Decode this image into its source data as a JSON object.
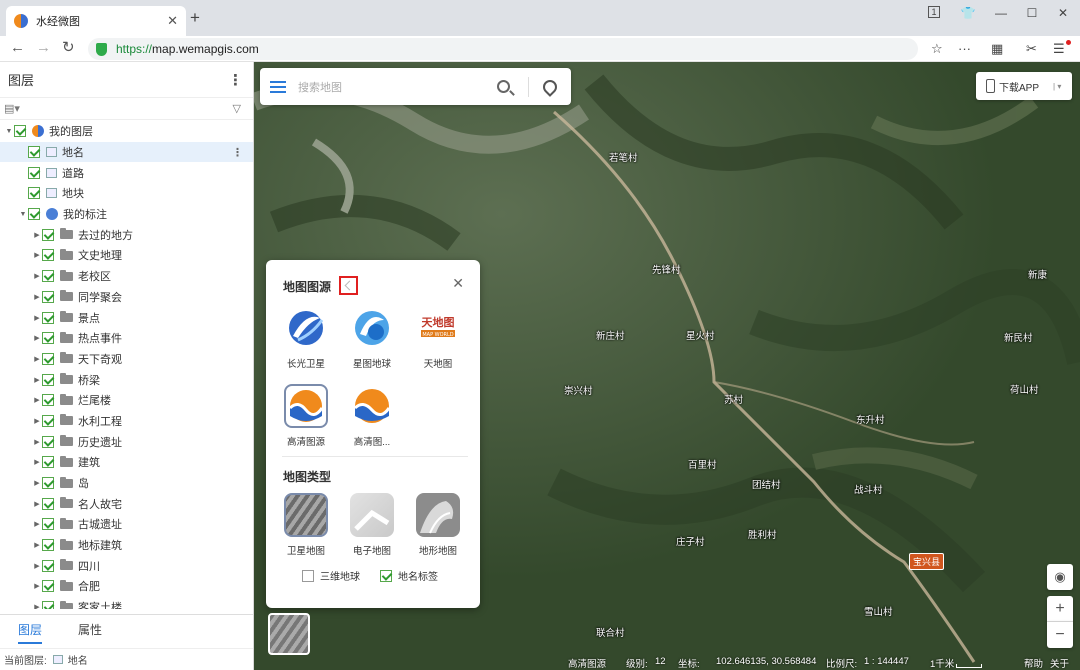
{
  "browser": {
    "tab_title": "水经微图",
    "url_scheme": "https://",
    "url_host": "map.wemapgis.com"
  },
  "left_panel": {
    "title": "图层",
    "tree": [
      {
        "label": "我的图层",
        "level": 0,
        "type": "globe",
        "checked": true,
        "expand": "down"
      },
      {
        "label": "地名",
        "level": 1,
        "type": "layer",
        "checked": true,
        "selected": true
      },
      {
        "label": "道路",
        "level": 1,
        "type": "layer",
        "checked": true
      },
      {
        "label": "地块",
        "level": 1,
        "type": "layer",
        "checked": true
      },
      {
        "label": "我的标注",
        "level": 1,
        "type": "globe2",
        "checked": true,
        "expand": "down"
      },
      {
        "label": "去过的地方",
        "level": 2,
        "type": "folder",
        "checked": true,
        "expand": "right"
      },
      {
        "label": "文史地理",
        "level": 2,
        "type": "folder",
        "checked": true,
        "expand": "right"
      },
      {
        "label": "老校区",
        "level": 2,
        "type": "folder",
        "checked": true,
        "expand": "right"
      },
      {
        "label": "同学聚会",
        "level": 2,
        "type": "folder",
        "checked": true,
        "expand": "right"
      },
      {
        "label": "景点",
        "level": 2,
        "type": "folder",
        "checked": true,
        "expand": "right"
      },
      {
        "label": "热点事件",
        "level": 2,
        "type": "folder",
        "checked": true,
        "expand": "right"
      },
      {
        "label": "天下奇观",
        "level": 2,
        "type": "folder",
        "checked": true,
        "expand": "right"
      },
      {
        "label": "桥梁",
        "level": 2,
        "type": "folder",
        "checked": true,
        "expand": "right"
      },
      {
        "label": "烂尾楼",
        "level": 2,
        "type": "folder",
        "checked": true,
        "expand": "right"
      },
      {
        "label": "水利工程",
        "level": 2,
        "type": "folder",
        "checked": true,
        "expand": "right"
      },
      {
        "label": "历史遗址",
        "level": 2,
        "type": "folder",
        "checked": true,
        "expand": "right"
      },
      {
        "label": "建筑",
        "level": 2,
        "type": "folder",
        "checked": true,
        "expand": "right"
      },
      {
        "label": "岛",
        "level": 2,
        "type": "folder",
        "checked": true,
        "expand": "right"
      },
      {
        "label": "名人故宅",
        "level": 2,
        "type": "folder",
        "checked": true,
        "expand": "right"
      },
      {
        "label": "古城遗址",
        "level": 2,
        "type": "folder",
        "checked": true,
        "expand": "right"
      },
      {
        "label": "地标建筑",
        "level": 2,
        "type": "folder",
        "checked": true,
        "expand": "right"
      },
      {
        "label": "四川",
        "level": 2,
        "type": "folder",
        "checked": true,
        "expand": "right"
      },
      {
        "label": "合肥",
        "level": 2,
        "type": "folder",
        "checked": true,
        "expand": "right"
      },
      {
        "label": "客家土楼",
        "level": 2,
        "type": "folder",
        "checked": true,
        "expand": "right"
      }
    ],
    "tabs": [
      "图层",
      "属性"
    ],
    "active_tab": 0,
    "status_label": "当前图层:",
    "status_value": "地名"
  },
  "map": {
    "search_placeholder": "搜索地图",
    "app_button": "下载APP",
    "villages": [
      {
        "name": "若笔村"
      },
      {
        "name": "先锋村"
      },
      {
        "name": "新庄村"
      },
      {
        "name": "星火村"
      },
      {
        "name": "崇兴村"
      },
      {
        "name": "苏村"
      },
      {
        "name": "东升村"
      },
      {
        "name": "百里村"
      },
      {
        "name": "团结村"
      },
      {
        "name": "战斗村"
      },
      {
        "name": "胜利村"
      },
      {
        "name": "庄子村"
      },
      {
        "name": "雪山村"
      },
      {
        "name": "联合村"
      },
      {
        "name": "新民村"
      },
      {
        "name": "荷山村"
      },
      {
        "name": "新康"
      }
    ],
    "town_label": "宝兴县",
    "popup": {
      "source_title": "地图图源",
      "sources": [
        {
          "label": "长光卫星",
          "icon": "changguang-satellite-icon"
        },
        {
          "label": "星图地球",
          "icon": "xingtu-earth-icon"
        },
        {
          "label": "天地图",
          "icon": "tianditu-icon"
        },
        {
          "label": "高清图源",
          "icon": "hd-source-icon",
          "selected": true
        },
        {
          "label": "高清图...",
          "icon": "hd-source-2-icon"
        }
      ],
      "type_title": "地图类型",
      "types": [
        {
          "label": "卫星地图",
          "selected": true
        },
        {
          "label": "电子地图"
        },
        {
          "label": "地形地图"
        }
      ],
      "opt_3d": "三维地球",
      "opt_3d_checked": false,
      "opt_labels": "地名标签",
      "opt_labels_checked": true
    },
    "status": {
      "source": "高清图源",
      "level_label": "级别:",
      "level_value": "12",
      "coord_label": "坐标:",
      "coord_value": "102.646135, 30.568484",
      "scale_label": "比例尺:",
      "scale_value": "1 : 144447",
      "scale_bar": "1千米",
      "help": "帮助",
      "about": "关于"
    }
  },
  "colors": {
    "accent": "#2a7ad9",
    "check": "#2e9a2e",
    "highlight": "#e02020"
  }
}
